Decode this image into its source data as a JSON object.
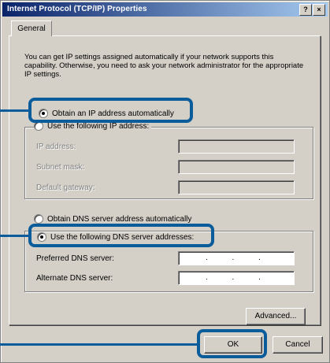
{
  "window": {
    "title": "Internet Protocol (TCP/IP) Properties",
    "help_button": "?",
    "close_button": "×"
  },
  "tabs": [
    {
      "label": "General",
      "selected": true
    }
  ],
  "description": "You can get IP settings assigned automatically if your network supports this capability. Otherwise, you need to ask your network administrator for the appropriate IP settings.",
  "ip_section": {
    "auto_radio": {
      "label": "Obtain an IP address automatically",
      "selected": true
    },
    "manual_radio": {
      "label": "Use the following IP address:",
      "selected": false
    },
    "fields": [
      {
        "label": "IP address:",
        "value": ""
      },
      {
        "label": "Subnet mask:",
        "value": ""
      },
      {
        "label": "Default gateway:",
        "value": ""
      }
    ]
  },
  "dns_section": {
    "auto_radio": {
      "label": "Obtain DNS server address automatically",
      "selected": false
    },
    "manual_radio": {
      "label": "Use the following DNS server addresses:",
      "selected": true
    },
    "fields": [
      {
        "label": "Preferred DNS server:",
        "value": ". . ."
      },
      {
        "label": "Alternate DNS server:",
        "value": ". . ."
      }
    ]
  },
  "buttons": {
    "advanced": "Advanced...",
    "ok": "OK",
    "cancel": "Cancel"
  },
  "colors": {
    "highlight": "#0b5c9a",
    "title_gradient_start": "#0a246a",
    "dialog_face": "#d4d0c8"
  }
}
